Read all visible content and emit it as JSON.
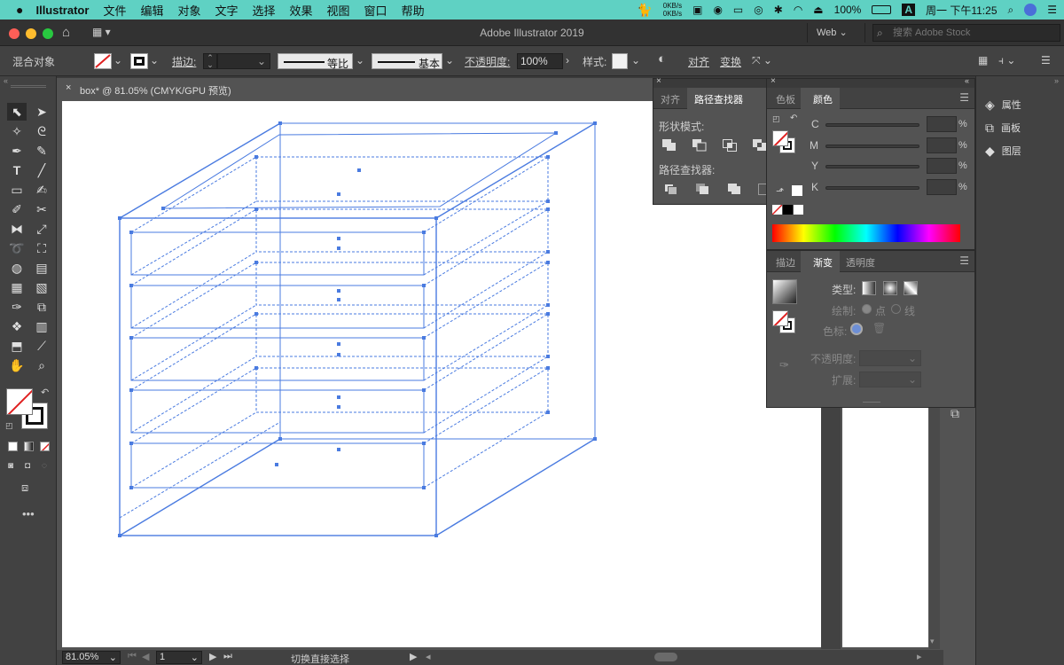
{
  "menubar": {
    "app": "Illustrator",
    "items": [
      "文件",
      "编辑",
      "对象",
      "文字",
      "选择",
      "效果",
      "视图",
      "窗口",
      "帮助"
    ],
    "net_up": "0KB/s",
    "net_down": "0KB/s",
    "battery": "100%",
    "clock": "周一 下午11:25"
  },
  "window": {
    "title": "Adobe Illustrator 2019",
    "workspace": "Web",
    "stock_search_placeholder": "搜索 Adobe Stock"
  },
  "controlbar": {
    "selection_type": "混合对象",
    "stroke_label": "描边:",
    "stroke_profile": "等比",
    "brush": "基本",
    "opacity_label": "不透明度:",
    "opacity_value": "100%",
    "style_label": "样式:",
    "align_label": "对齐",
    "transform_label": "变换"
  },
  "document": {
    "tab_title": "box* @ 81.05% (CMYK/GPU 预览)",
    "zoom": "81.05%",
    "artboard": "1",
    "status_text": "切换直接选择"
  },
  "pathfinder_panel": {
    "tabs": [
      "对齐",
      "路径查找器"
    ],
    "active_tab": "路径查找器",
    "shape_modes_label": "形状模式:",
    "pathfinders_label": "路径查找器:"
  },
  "color_panel": {
    "tabs": [
      "色板",
      "颜色"
    ],
    "active_tab": "颜色",
    "channels": [
      "C",
      "M",
      "Y",
      "K"
    ],
    "percent": "%"
  },
  "gradient_panel": {
    "tabs": [
      "描边",
      "渐变",
      "透明度"
    ],
    "active_tab": "渐变",
    "type_label": "类型:",
    "draw_label": "绘制:",
    "draw_point": "点",
    "draw_line": "线",
    "stop_label": "色标:",
    "opacity_label": "不透明度:",
    "expand_label": "扩展:"
  },
  "right_dock": {
    "items": [
      "属性",
      "画板",
      "图层"
    ]
  },
  "colors": {
    "menubar_bg": "#5fd1c3",
    "selection_blue": "#4a7be0",
    "panel_bg": "#535353",
    "dark_bg": "#424242"
  }
}
